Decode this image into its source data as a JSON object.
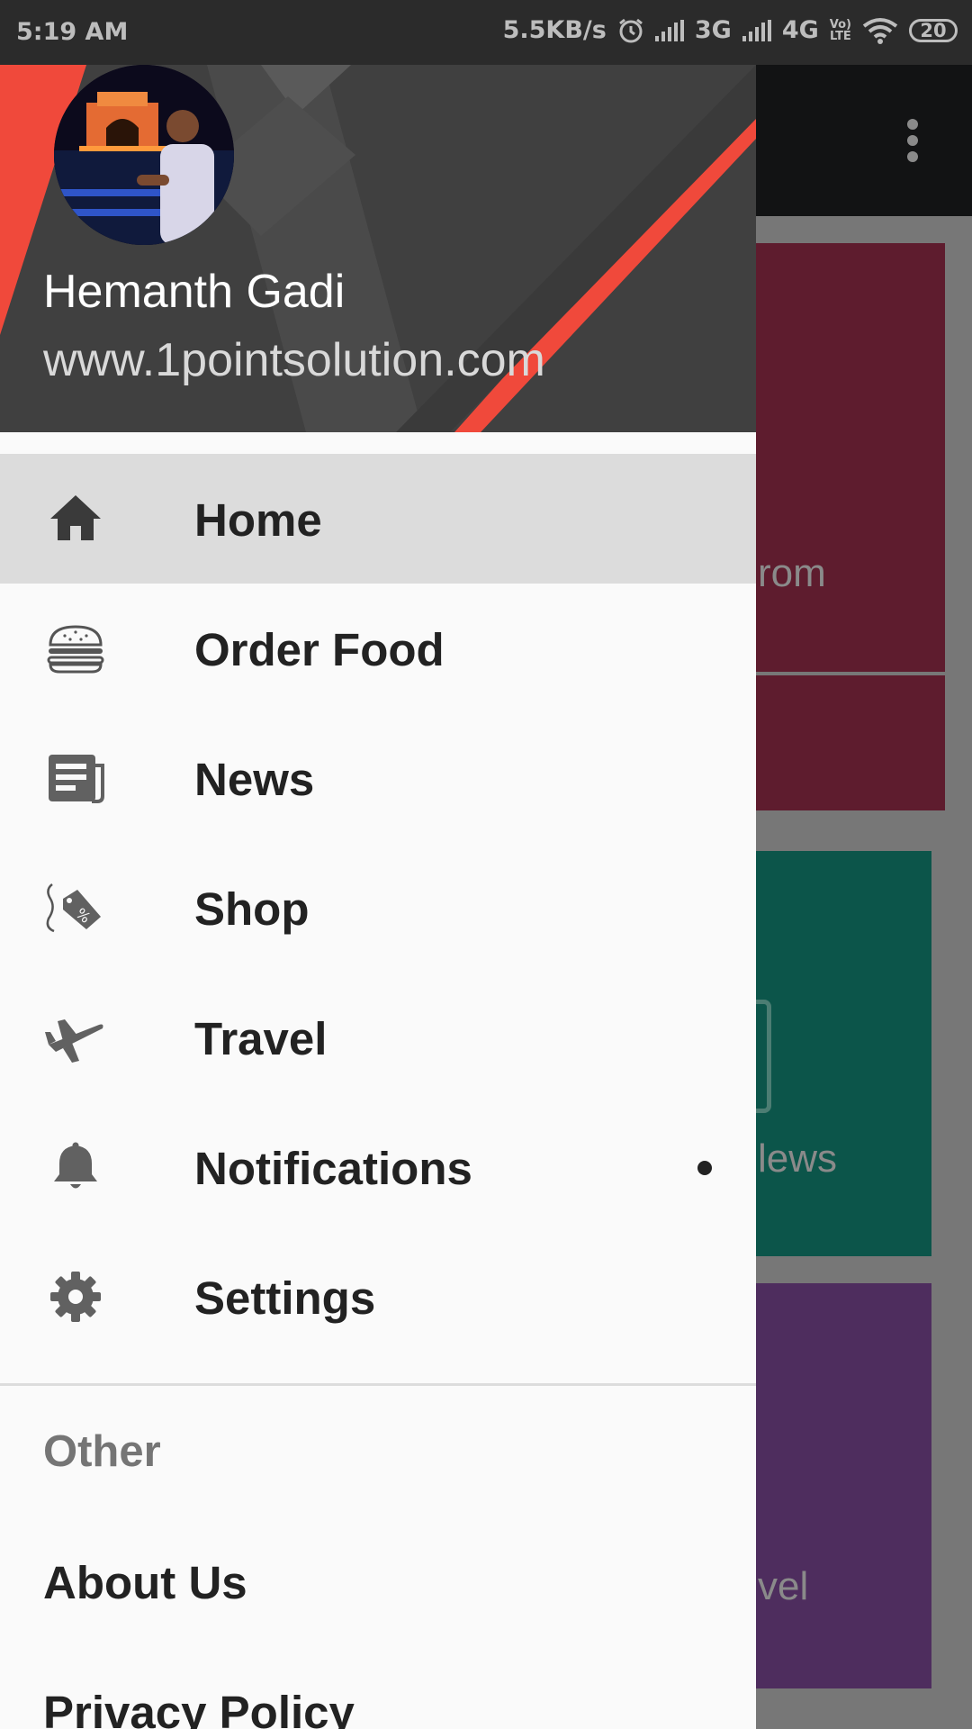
{
  "status_bar": {
    "time": "5:19 AM",
    "speed": "5.5KB/s",
    "net1": "3G",
    "net2": "4G",
    "volte_top": "Vo)",
    "volte_bottom": "LTE",
    "battery": "20"
  },
  "background": {
    "card1_text": "rom",
    "card2_text": "lews",
    "card3_text": "vel",
    "colors": {
      "card1": "#5e1c2e",
      "card2": "#0c554a",
      "card3": "#4e2d5e",
      "toolbar": "#121314"
    }
  },
  "drawer": {
    "user_name": "Hemanth Gadi",
    "user_website": "www.1pointsolution.com",
    "menu": [
      {
        "label": "Home",
        "icon": "home-icon",
        "active": true
      },
      {
        "label": "Order Food",
        "icon": "burger-icon"
      },
      {
        "label": "News",
        "icon": "newspaper-icon"
      },
      {
        "label": "Shop",
        "icon": "price-tag-icon"
      },
      {
        "label": "Travel",
        "icon": "airplane-icon"
      },
      {
        "label": "Notifications",
        "icon": "bell-icon"
      },
      {
        "label": "Settings",
        "icon": "gear-icon"
      }
    ],
    "other_section": {
      "header": "Other",
      "items": [
        "About Us",
        "Privacy Policy"
      ]
    },
    "colors": {
      "accent_red": "#f0493b",
      "header_bg": "#404040",
      "active_bg": "#dcdcdc"
    }
  }
}
